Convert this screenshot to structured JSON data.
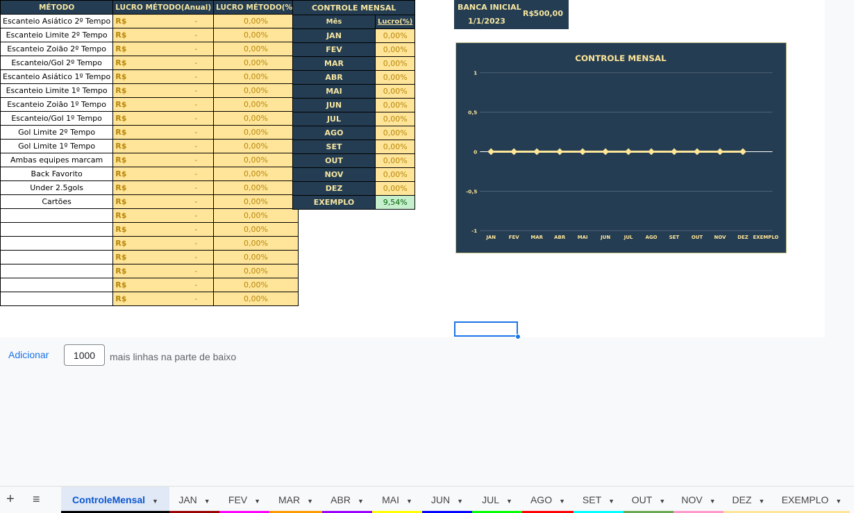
{
  "methods_table": {
    "headers": [
      "MÉTODO",
      "LUCRO MÉTODO(Anual)",
      "LUCRO MÉTODO(%)"
    ],
    "currency": "R$",
    "dash": "-",
    "rows": [
      {
        "name": "Escanteio Asiático 2º Tempo",
        "pct": "0,00%"
      },
      {
        "name": "Escanteio Limite 2º Tempo",
        "pct": "0,00%"
      },
      {
        "name": "Escanteio Zoião 2º Tempo",
        "pct": "0,00%"
      },
      {
        "name": "Escanteio/Gol 2º Tempo",
        "pct": "0,00%"
      },
      {
        "name": "Escanteio Asiático 1º Tempo",
        "pct": "0,00%"
      },
      {
        "name": "Escanteio Limite 1º Tempo",
        "pct": "0,00%"
      },
      {
        "name": "Escanteio Zoião 1º Tempo",
        "pct": "0,00%"
      },
      {
        "name": "Escanteio/Gol 1º Tempo",
        "pct": "0,00%"
      },
      {
        "name": "Gol Limite 2º Tempo",
        "pct": "0,00%"
      },
      {
        "name": "Gol Limite 1º Tempo",
        "pct": "0,00%"
      },
      {
        "name": "Ambas equipes marcam",
        "pct": "0,00%"
      },
      {
        "name": "Back Favorito",
        "pct": "0,00%"
      },
      {
        "name": "Under 2.5gols",
        "pct": "0,00%"
      },
      {
        "name": "Cartões",
        "pct": "0,00%"
      },
      {
        "name": "",
        "pct": "0,00%"
      },
      {
        "name": "",
        "pct": "0,00%"
      },
      {
        "name": "",
        "pct": "0,00%"
      },
      {
        "name": "",
        "pct": "0,00%"
      },
      {
        "name": "",
        "pct": "0,00%"
      },
      {
        "name": "",
        "pct": "0,00%"
      },
      {
        "name": "",
        "pct": "0,00%"
      }
    ]
  },
  "monthly_table": {
    "title": "CONTROLE MENSAL",
    "col_month": "Mês",
    "col_profit": "Lucro(%)",
    "rows": [
      {
        "month": "JAN",
        "value": "0,00%"
      },
      {
        "month": "FEV",
        "value": "0,00%"
      },
      {
        "month": "MAR",
        "value": "0,00%"
      },
      {
        "month": "ABR",
        "value": "0,00%"
      },
      {
        "month": "MAI",
        "value": "0,00%"
      },
      {
        "month": "JUN",
        "value": "0,00%"
      },
      {
        "month": "JUL",
        "value": "0,00%"
      },
      {
        "month": "AGO",
        "value": "0,00%"
      },
      {
        "month": "SET",
        "value": "0,00%"
      },
      {
        "month": "OUT",
        "value": "0,00%"
      },
      {
        "month": "NOV",
        "value": "0,00%"
      },
      {
        "month": "DEZ",
        "value": "0,00%"
      },
      {
        "month": "EXEMPLO",
        "value": "9,54%"
      }
    ]
  },
  "banca": {
    "label": "BANCA INICIAL",
    "currency": "R$",
    "amount": "500,00",
    "date": "1/1/2023"
  },
  "chart_data": {
    "type": "line",
    "title": "CONTROLE MENSAL",
    "categories": [
      "JAN",
      "FEV",
      "MAR",
      "ABR",
      "MAI",
      "JUN",
      "JUL",
      "AGO",
      "SET",
      "OUT",
      "NOV",
      "DEZ",
      "EXEMPLO"
    ],
    "series": [
      {
        "values": [
          0,
          0,
          0,
          0,
          0,
          0,
          0,
          0,
          0,
          0,
          0,
          0,
          null
        ]
      }
    ],
    "yticks": [
      "1",
      "0,5",
      "0",
      "-0,5",
      "-1"
    ],
    "ylim": [
      -1,
      1
    ],
    "grid": true,
    "legend": "none",
    "colors": {
      "background": "#253d52",
      "line": "#ffe699",
      "text": "#ffe699",
      "grid": "#5b6e80"
    }
  },
  "add_rows": {
    "link": "Adicionar",
    "count": "1000",
    "suffix": "mais linhas na parte de baixo"
  },
  "tabs": {
    "add_icon": "+",
    "menu_icon": "≡",
    "caret": "▼",
    "items": [
      {
        "label": "ControleMensal",
        "color": "#000000"
      },
      {
        "label": "JAN",
        "color": "#990000"
      },
      {
        "label": "FEV",
        "color": "#ff00ff"
      },
      {
        "label": "MAR",
        "color": "#ff9900"
      },
      {
        "label": "ABR",
        "color": "#9900ff"
      },
      {
        "label": "MAI",
        "color": "#ffff00"
      },
      {
        "label": "JUN",
        "color": "#0000ff"
      },
      {
        "label": "JUL",
        "color": "#00ff00"
      },
      {
        "label": "AGO",
        "color": "#ff0000"
      },
      {
        "label": "SET",
        "color": "#00ffff"
      },
      {
        "label": "OUT",
        "color": "#6aa84f"
      },
      {
        "label": "NOV",
        "color": "#ff99cc"
      },
      {
        "label": "DEZ",
        "color": "#ffe599"
      },
      {
        "label": "EXEMPLO",
        "color": "#ffe599"
      }
    ]
  }
}
